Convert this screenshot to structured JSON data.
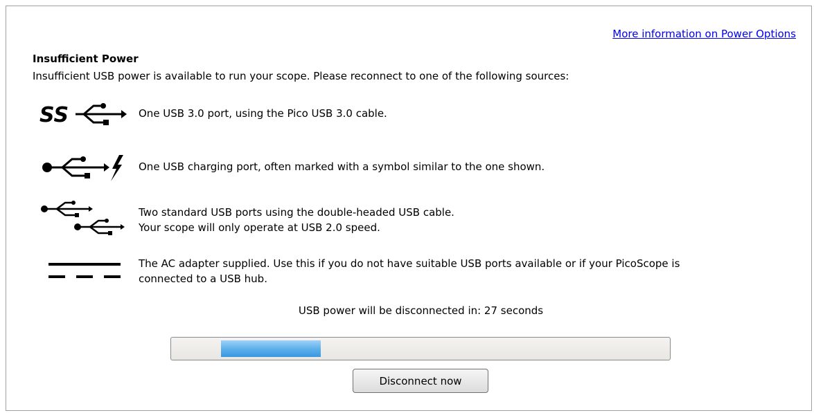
{
  "header": {
    "more_info_link": "More information on Power Options",
    "heading": "Insufficient Power",
    "intro": "Insufficient USB power is available to run your scope. Please reconnect to one of the following sources:"
  },
  "options": [
    {
      "icon": "usb3-superspeed-icon",
      "lines": [
        "One USB 3.0 port, using the Pico USB 3.0 cable."
      ]
    },
    {
      "icon": "usb-charging-icon",
      "lines": [
        "One USB charging port, often marked with a symbol similar to the one shown."
      ]
    },
    {
      "icon": "double-usb-icon",
      "lines": [
        "Two standard USB ports using the double-headed USB cable.",
        "Your scope will only operate at USB 2.0 speed."
      ]
    },
    {
      "icon": "dc-power-icon",
      "lines": [
        "The AC adapter supplied. Use this if you do not have suitable USB ports available or if your PicoScope is",
        "connected to a USB hub."
      ]
    }
  ],
  "countdown": {
    "text": "USB power will be disconnected in: 27 seconds"
  },
  "progress": {
    "fill_start_fraction": 0.1,
    "fill_end_fraction": 0.3
  },
  "disconnect_button": "Disconnect now",
  "colors": {
    "link": "#0000ee",
    "progress_fill": "#5aaee9",
    "border": "#a0a0a0"
  }
}
